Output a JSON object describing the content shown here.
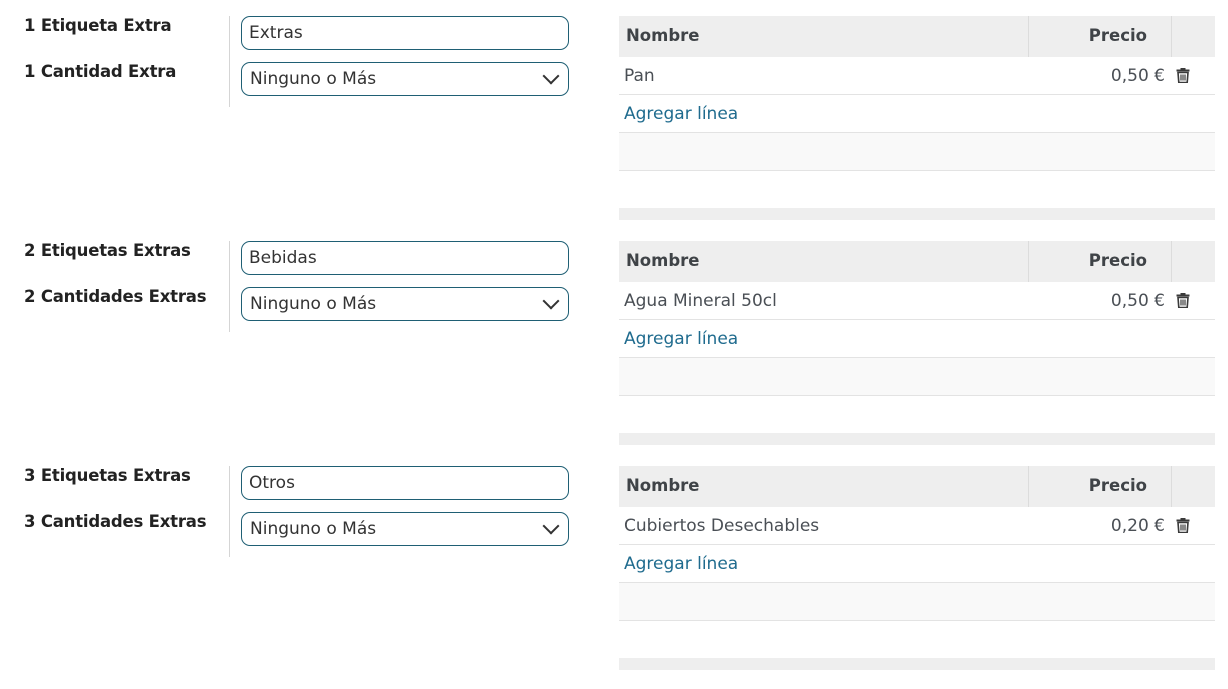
{
  "groups": [
    {
      "label_tag": "1 Etiqueta Extra",
      "label_qty": "1 Cantidad Extra",
      "tag_value": "Extras",
      "qty_value": "Ninguno o Más",
      "table": {
        "col_name": "Nombre",
        "col_price": "Precio",
        "rows": [
          {
            "name": "Pan",
            "price": "0,50 €"
          }
        ],
        "add_line": "Agregar línea"
      }
    },
    {
      "label_tag": "2 Etiquetas Extras",
      "label_qty": "2 Cantidades Extras",
      "tag_value": "Bebidas",
      "qty_value": "Ninguno o Más",
      "table": {
        "col_name": "Nombre",
        "col_price": "Precio",
        "rows": [
          {
            "name": "Agua Mineral 50cl",
            "price": "0,50 €"
          }
        ],
        "add_line": "Agregar línea"
      }
    },
    {
      "label_tag": "3 Etiquetas Extras",
      "label_qty": "3 Cantidades Extras",
      "tag_value": "Otros",
      "qty_value": "Ninguno o Más",
      "table": {
        "col_name": "Nombre",
        "col_price": "Precio",
        "rows": [
          {
            "name": "Cubiertos Desechables",
            "price": "0,20 €"
          }
        ],
        "add_line": "Agregar línea"
      }
    }
  ],
  "icons": {
    "delete": "trash-icon",
    "dropdown": "chevron-down-icon"
  },
  "colors": {
    "input_border": "#1f5f74",
    "link": "#1f6b8e",
    "header_bg": "#eeeeee"
  }
}
